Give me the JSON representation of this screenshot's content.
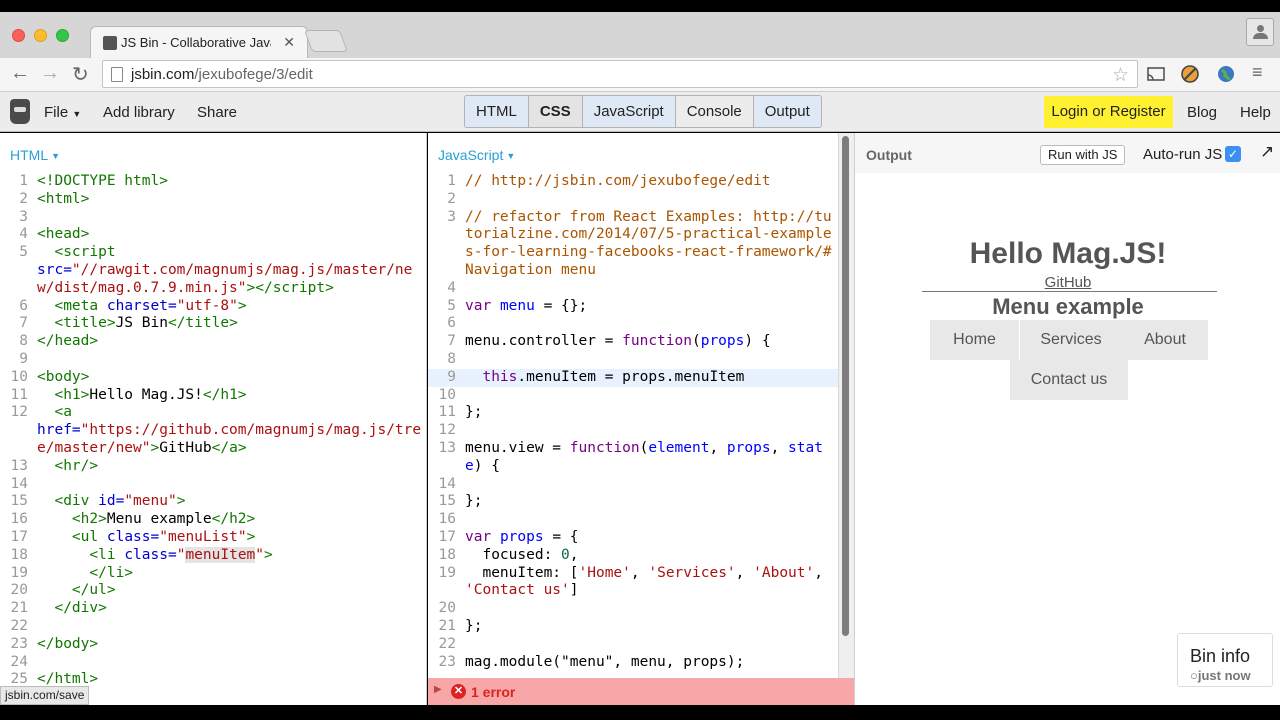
{
  "browser": {
    "tab_title": "JS Bin - Collaborative Java",
    "url_host": "jsbin.com",
    "url_path": "/jexubofege/3/edit",
    "status_url": "jsbin.com/save"
  },
  "jsbin_bar": {
    "file": "File",
    "add_library": "Add library",
    "share": "Share",
    "panels": [
      "HTML",
      "CSS",
      "JavaScript",
      "Console",
      "Output"
    ],
    "login": "Login or Register",
    "blog": "Blog",
    "help": "Help"
  },
  "html_panel": {
    "label": "HTML",
    "lines": [
      {
        "n": "1",
        "html": "<span class='t-tag'>&lt;!DOCTYPE html&gt;</span>"
      },
      {
        "n": "2",
        "html": "<span class='t-tag'>&lt;html&gt;</span>"
      },
      {
        "n": "3",
        "html": ""
      },
      {
        "n": "4",
        "html": "<span class='t-tag'>&lt;head&gt;</span>"
      },
      {
        "n": "5",
        "html": "  <span class='t-tag'>&lt;script</span>\n<span class='t-attr'>src=</span><span class='t-str'>\"//rawgit.com/magnumjs/mag.js/master/new/dist/mag.0.7.9.min.js\"</span><span class='t-tag'>&gt;&lt;/script&gt;</span>"
      },
      {
        "n": "6",
        "html": "  <span class='t-tag'>&lt;meta</span> <span class='t-attr'>charset=</span><span class='t-str'>\"utf-8\"</span><span class='t-tag'>&gt;</span>"
      },
      {
        "n": "7",
        "html": "  <span class='t-tag'>&lt;title&gt;</span>JS Bin<span class='t-tag'>&lt;/title&gt;</span>"
      },
      {
        "n": "8",
        "html": "<span class='t-tag'>&lt;/head&gt;</span>"
      },
      {
        "n": "9",
        "html": ""
      },
      {
        "n": "10",
        "html": "<span class='t-tag'>&lt;body&gt;</span>"
      },
      {
        "n": "11",
        "html": "  <span class='t-tag'>&lt;h1&gt;</span>Hello Mag.JS!<span class='t-tag'>&lt;/h1&gt;</span>"
      },
      {
        "n": "12",
        "html": "  <span class='t-tag'>&lt;a</span>\n<span class='t-attr'>href=</span><span class='t-str'>\"https://github.com/magnumjs/mag.js/tree/master/new\"</span><span class='t-tag'>&gt;</span>GitHub<span class='t-tag'>&lt;/a&gt;</span>"
      },
      {
        "n": "13",
        "html": "  <span class='t-tag'>&lt;hr/&gt;</span>"
      },
      {
        "n": "14",
        "html": ""
      },
      {
        "n": "15",
        "html": "  <span class='t-tag'>&lt;div</span> <span class='t-attr'>id=</span><span class='t-str'>\"menu\"</span><span class='t-tag'>&gt;</span>"
      },
      {
        "n": "16",
        "html": "    <span class='t-tag'>&lt;h2&gt;</span>Menu example<span class='t-tag'>&lt;/h2&gt;</span>"
      },
      {
        "n": "17",
        "html": "    <span class='t-tag'>&lt;ul</span> <span class='t-attr'>class=</span><span class='t-str'>\"menuList\"</span><span class='t-tag'>&gt;</span>"
      },
      {
        "n": "18",
        "html": "      <span class='t-tag'>&lt;li</span> <span class='t-attr'>class=</span><span class='t-str'>\"<span class='t-hl'>menuItem</span>\"</span><span class='t-tag'>&gt;</span>"
      },
      {
        "n": "19",
        "html": "      <span class='t-tag'>&lt;/li&gt;</span>"
      },
      {
        "n": "20",
        "html": "    <span class='t-tag'>&lt;/ul&gt;</span>"
      },
      {
        "n": "21",
        "html": "  <span class='t-tag'>&lt;/div&gt;</span>"
      },
      {
        "n": "22",
        "html": ""
      },
      {
        "n": "23",
        "html": "<span class='t-tag'>&lt;/body&gt;</span>"
      },
      {
        "n": "24",
        "html": ""
      },
      {
        "n": "25",
        "html": "<span class='t-tag'>&lt;/html&gt;</span>"
      }
    ]
  },
  "js_panel": {
    "label": "JavaScript",
    "active_line": "9",
    "lines": [
      {
        "n": "1",
        "html": "<span class='t-com'>// http://jsbin.com/jexubofege/edit</span>"
      },
      {
        "n": "2",
        "html": ""
      },
      {
        "n": "3",
        "html": "<span class='t-com'>// refactor from React Examples: http://tutorialzine.com/2014/07/5-practical-examples-for-learning-facebooks-react-framework/#Navigation menu</span>"
      },
      {
        "n": "4",
        "html": ""
      },
      {
        "n": "5",
        "html": "<span class='t-kw'>var</span> <span class='t-def'>menu</span> = {};"
      },
      {
        "n": "6",
        "html": ""
      },
      {
        "n": "7",
        "html": "menu.controller = <span class='t-kw'>function</span>(<span class='t-def'>props</span>) {"
      },
      {
        "n": "8",
        "html": ""
      },
      {
        "n": "9",
        "html": "  <span class='t-kw'>this</span>.menuItem = props.menuItem"
      },
      {
        "n": "10",
        "html": ""
      },
      {
        "n": "11",
        "html": "};"
      },
      {
        "n": "12",
        "html": ""
      },
      {
        "n": "13",
        "html": "menu.view = <span class='t-kw'>function</span>(<span class='t-def'>element</span>, <span class='t-def'>props</span>, <span class='t-def'>state</span>) {"
      },
      {
        "n": "14",
        "html": ""
      },
      {
        "n": "15",
        "html": "};"
      },
      {
        "n": "16",
        "html": ""
      },
      {
        "n": "17",
        "html": "<span class='t-kw'>var</span> <span class='t-def'>props</span> = {"
      },
      {
        "n": "18",
        "html": "  focused: <span class='t-num'>0</span>,"
      },
      {
        "n": "19",
        "html": "  menuItem: [<span class='t-str'>'Home'</span>, <span class='t-str'>'Services'</span>, <span class='t-str'>'About'</span>, <span class='t-str'>'Contact us'</span>]"
      },
      {
        "n": "20",
        "html": ""
      },
      {
        "n": "21",
        "html": "};"
      },
      {
        "n": "22",
        "html": ""
      },
      {
        "n": "23",
        "html": "mag.module(\"menu\", menu, props);"
      }
    ]
  },
  "output_panel": {
    "label": "Output",
    "run_button": "Run with JS",
    "auto_run": "Auto-run JS",
    "auto_run_checked": true,
    "h1": "Hello Mag.JS!",
    "link": "GitHub",
    "h2": "Menu example",
    "menu_items": [
      "Home",
      "Services",
      "About",
      "Contact us"
    ],
    "bin_info_title": "Bin info",
    "bin_info_sub": "just now"
  },
  "error_bar": {
    "text": "1 error"
  }
}
